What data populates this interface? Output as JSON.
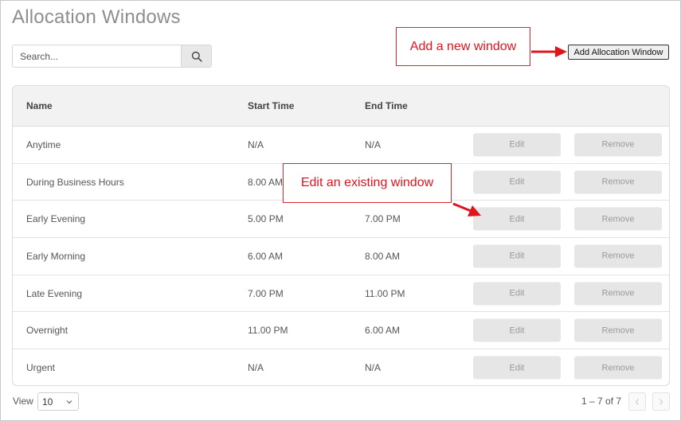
{
  "page": {
    "title": "Allocation Windows"
  },
  "search": {
    "placeholder": "Search...",
    "value": ""
  },
  "toolbar": {
    "add_label": "Add Allocation Window"
  },
  "table": {
    "columns": [
      "Name",
      "Start Time",
      "End Time"
    ],
    "rows": [
      {
        "name": "Anytime",
        "start": "N/A",
        "end": "N/A"
      },
      {
        "name": "During Business Hours",
        "start": "8.00 AM",
        "end": ""
      },
      {
        "name": "Early Evening",
        "start": "5.00 PM",
        "end": "7.00 PM"
      },
      {
        "name": "Early Morning",
        "start": "6.00 AM",
        "end": "8.00 AM"
      },
      {
        "name": "Late Evening",
        "start": "7.00 PM",
        "end": "11.00 PM"
      },
      {
        "name": "Overnight",
        "start": "11.00 PM",
        "end": "6.00 AM"
      },
      {
        "name": "Urgent",
        "start": "N/A",
        "end": "N/A"
      }
    ],
    "edit_label": "Edit",
    "remove_label": "Remove"
  },
  "footer": {
    "view_label": "View",
    "view_value": "10",
    "pager_text": "1 – 7 of 7"
  },
  "annotations": {
    "add_callout": "Add a new window",
    "edit_callout": "Edit an existing window"
  },
  "icons": {
    "search": "search-icon",
    "select": "chevron-down-icon",
    "prev": "chevron-left-icon",
    "next": "chevron-right-icon"
  },
  "colors": {
    "annotation": "#e0141c",
    "button_bg": "#e6e6e6",
    "header_bg": "#f2f2f2"
  }
}
